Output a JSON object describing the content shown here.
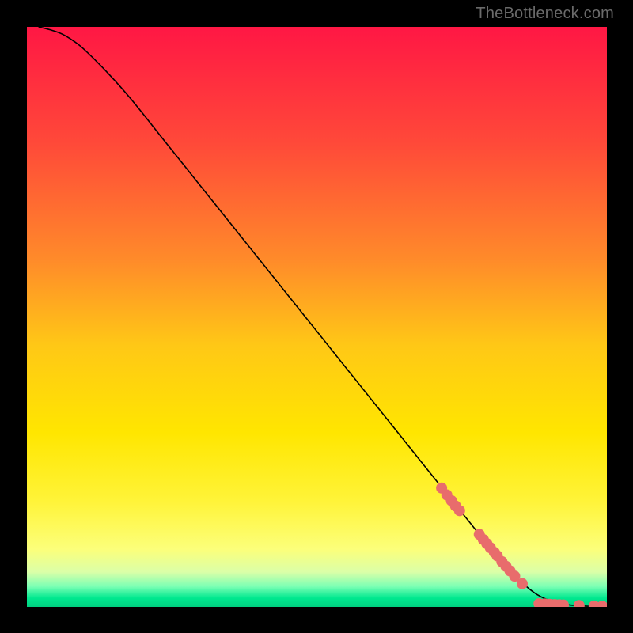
{
  "attribution": "TheBottleneck.com",
  "chart_data": {
    "type": "line",
    "title": "",
    "xlabel": "",
    "ylabel": "",
    "xlim": [
      0,
      100
    ],
    "ylim": [
      0,
      100
    ],
    "grid": false,
    "background_gradient": {
      "direction": "vertical",
      "stops": [
        {
          "pos": 0.0,
          "color": "#ff1744"
        },
        {
          "pos": 0.2,
          "color": "#ff4939"
        },
        {
          "pos": 0.4,
          "color": "#ff8a2a"
        },
        {
          "pos": 0.55,
          "color": "#ffc816"
        },
        {
          "pos": 0.7,
          "color": "#ffe600"
        },
        {
          "pos": 0.82,
          "color": "#fff43a"
        },
        {
          "pos": 0.9,
          "color": "#fcff7a"
        },
        {
          "pos": 0.94,
          "color": "#dbffa8"
        },
        {
          "pos": 0.965,
          "color": "#7affb4"
        },
        {
          "pos": 0.985,
          "color": "#00e88f"
        },
        {
          "pos": 1.0,
          "color": "#00d080"
        }
      ]
    },
    "series": [
      {
        "name": "bottleneck-curve",
        "stroke": "#000000",
        "x": [
          2,
          4,
          6,
          8,
          10,
          14,
          18,
          24,
          30,
          38,
          46,
          54,
          62,
          70,
          76,
          80,
          82,
          85,
          88,
          91,
          94,
          97,
          100
        ],
        "y": [
          100,
          99.5,
          98.8,
          97.6,
          96,
          92,
          87.5,
          80,
          72.5,
          62.5,
          52.5,
          42.5,
          32.5,
          22.5,
          15,
          10,
          7.5,
          4.5,
          2.1,
          0.8,
          0.3,
          0.12,
          0.08
        ]
      }
    ],
    "markers": {
      "name": "highlighted-points",
      "color": "#e86c6c",
      "radius": 7,
      "points": [
        {
          "x": 71.5,
          "y": 20.5
        },
        {
          "x": 72.4,
          "y": 19.3
        },
        {
          "x": 73.2,
          "y": 18.3
        },
        {
          "x": 73.9,
          "y": 17.4
        },
        {
          "x": 74.6,
          "y": 16.6
        },
        {
          "x": 78.0,
          "y": 12.5
        },
        {
          "x": 78.7,
          "y": 11.6
        },
        {
          "x": 79.3,
          "y": 10.9
        },
        {
          "x": 79.9,
          "y": 10.2
        },
        {
          "x": 80.6,
          "y": 9.4
        },
        {
          "x": 81.1,
          "y": 8.8
        },
        {
          "x": 81.9,
          "y": 7.8
        },
        {
          "x": 82.6,
          "y": 7.0
        },
        {
          "x": 83.3,
          "y": 6.2
        },
        {
          "x": 84.1,
          "y": 5.3
        },
        {
          "x": 85.4,
          "y": 4.0
        },
        {
          "x": 88.3,
          "y": 0.55
        },
        {
          "x": 89.3,
          "y": 0.5
        },
        {
          "x": 90.1,
          "y": 0.45
        },
        {
          "x": 91.0,
          "y": 0.4
        },
        {
          "x": 91.8,
          "y": 0.36
        },
        {
          "x": 92.5,
          "y": 0.33
        },
        {
          "x": 95.2,
          "y": 0.24
        },
        {
          "x": 97.8,
          "y": 0.16
        },
        {
          "x": 99.2,
          "y": 0.12
        }
      ]
    }
  }
}
